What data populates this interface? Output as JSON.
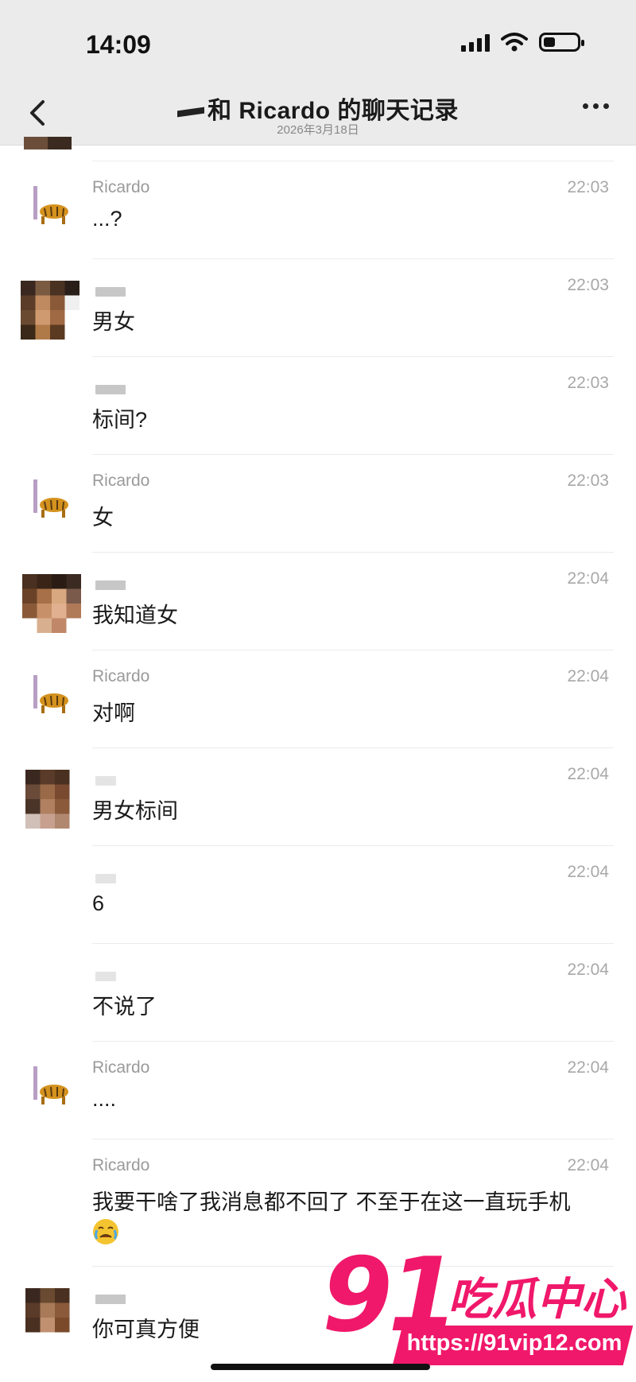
{
  "status": {
    "time": "14:09"
  },
  "nav": {
    "title": "和 Ricardo 的聊天记录",
    "date": "2026年3月18日"
  },
  "messages": [
    {
      "sender": "Ricardo",
      "avatar": "tiger",
      "time": "22:03",
      "text": "...?"
    },
    {
      "sender": "",
      "avatar": "pixel",
      "time": "22:03",
      "text": "男女"
    },
    {
      "sender": "",
      "avatar": "none",
      "time": "22:03",
      "text": "标间?"
    },
    {
      "sender": "Ricardo",
      "avatar": "tiger",
      "time": "22:03",
      "text": "女"
    },
    {
      "sender": "",
      "avatar": "pixel",
      "time": "22:04",
      "text": "我知道女"
    },
    {
      "sender": "Ricardo",
      "avatar": "tiger",
      "time": "22:04",
      "text": "对啊"
    },
    {
      "sender": "",
      "avatar": "pixel",
      "time": "22:04",
      "text": "男女标间"
    },
    {
      "sender": "",
      "avatar": "none",
      "time": "22:04",
      "text": "6"
    },
    {
      "sender": "",
      "avatar": "none",
      "time": "22:04",
      "text": "不说了"
    },
    {
      "sender": "Ricardo",
      "avatar": "tiger",
      "time": "22:04",
      "text": "...."
    },
    {
      "sender": "Ricardo",
      "avatar": "none",
      "time": "22:04",
      "text": "我要干啥了我消息都不回了 不至于在这一直玩手机"
    },
    {
      "sender": "",
      "avatar": "pixel",
      "time": "",
      "text": "你可真方便"
    }
  ],
  "watermark": {
    "number": "91",
    "brand": "吃瓜中心",
    "url": "https://91vip12.com"
  },
  "colors": {
    "accent": "#f0186a",
    "time": "#a8a8a8",
    "header_bg": "#ebebeb"
  }
}
